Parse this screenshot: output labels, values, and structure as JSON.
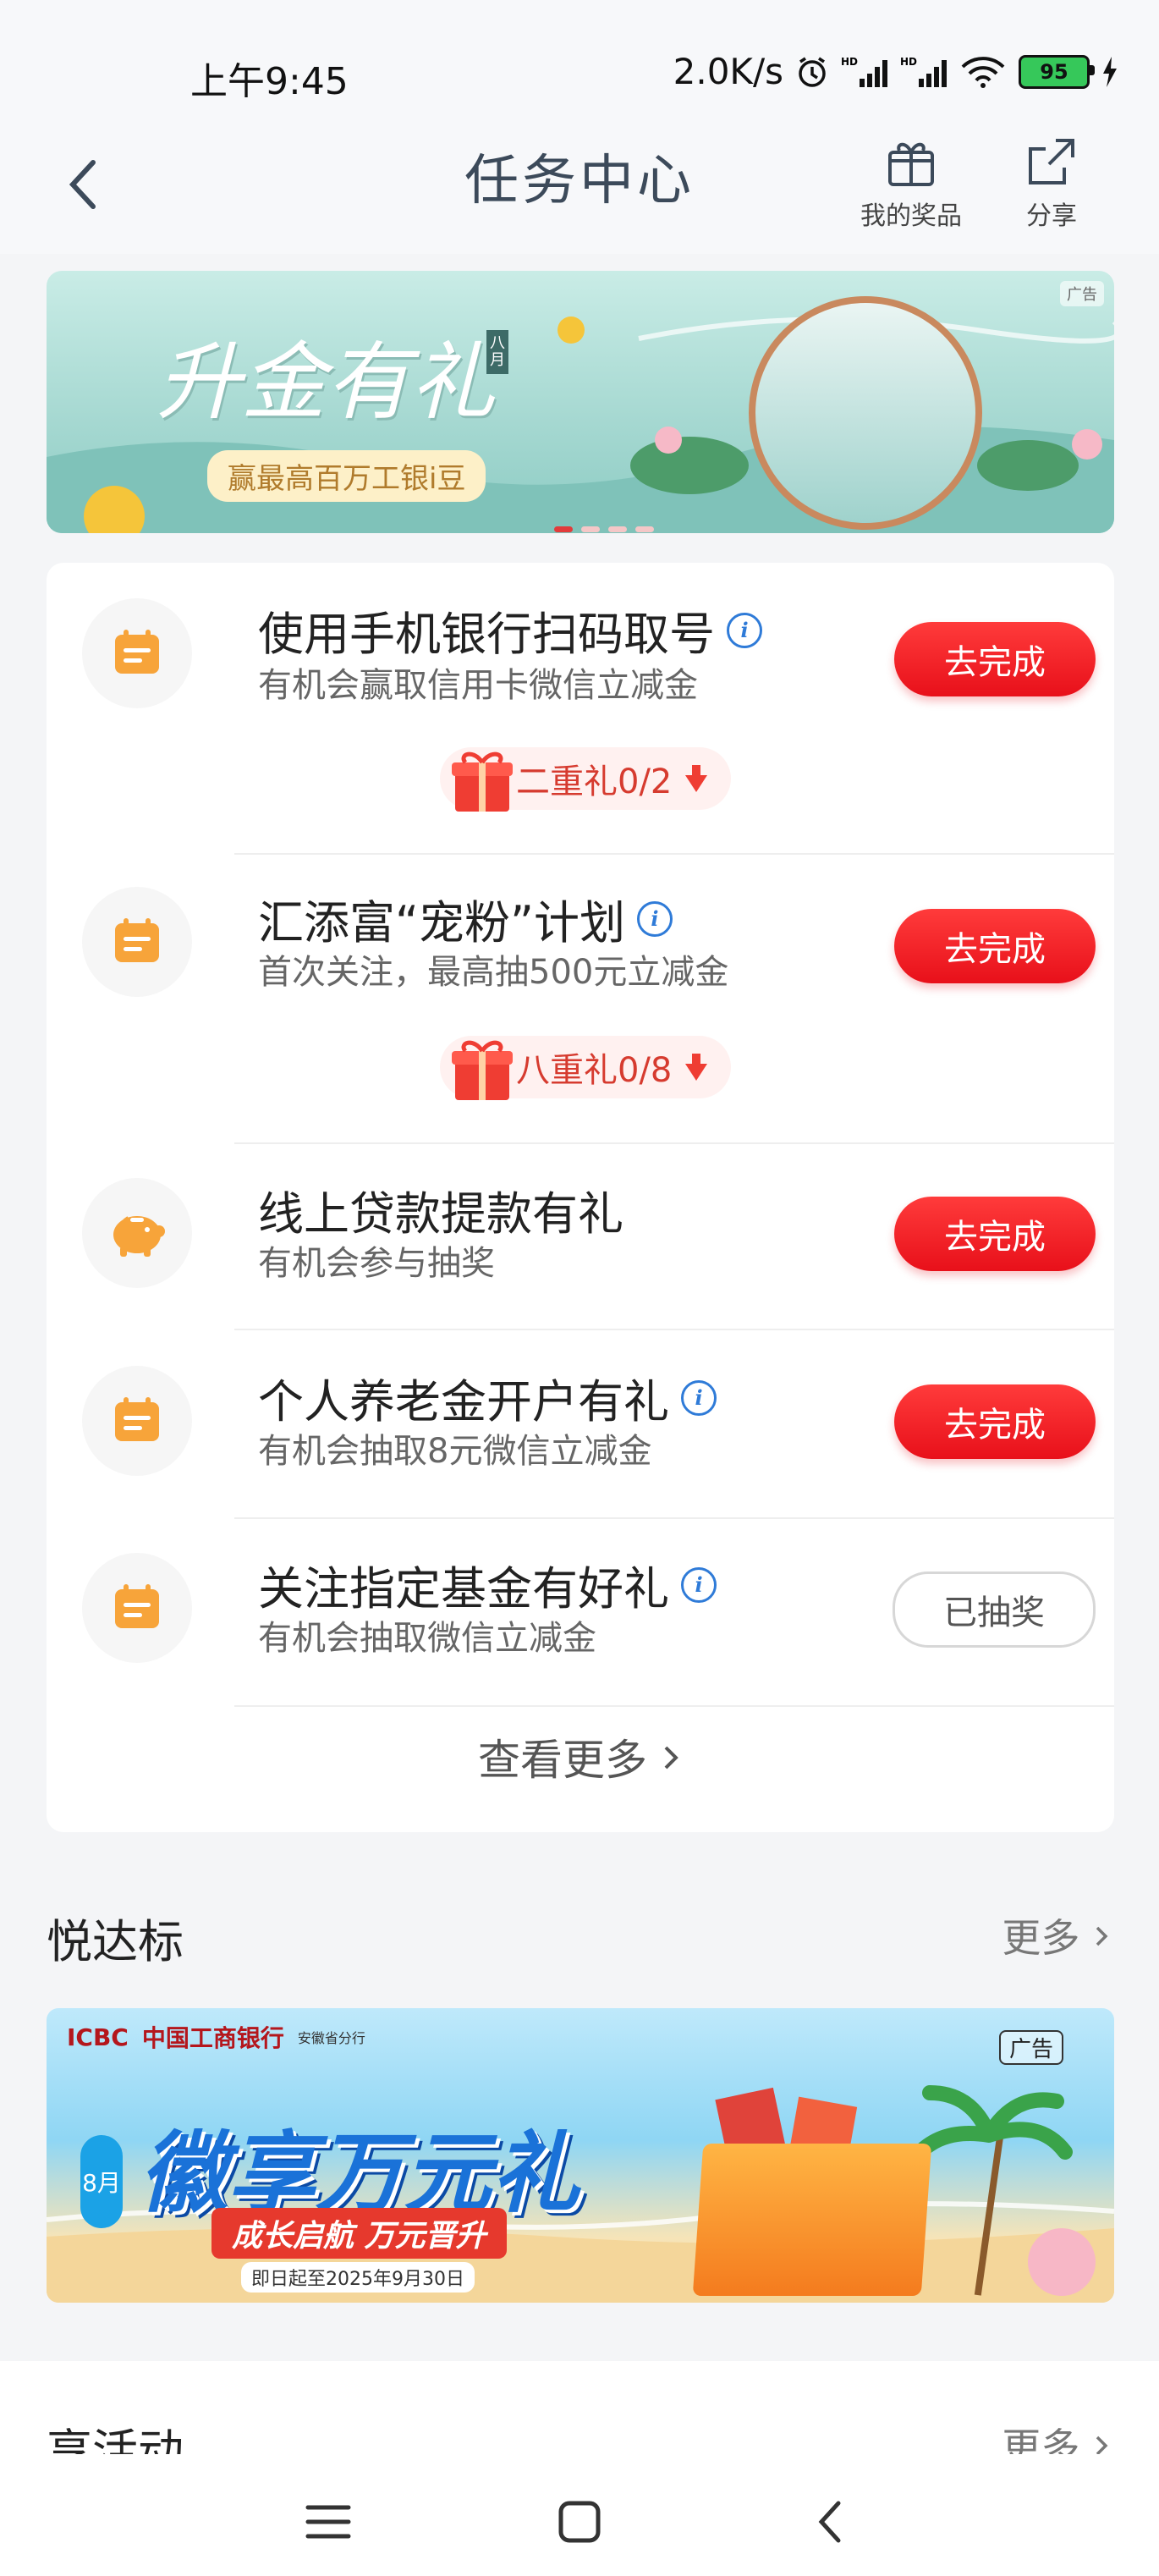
{
  "status_bar": {
    "time": "上午9:45",
    "network_speed": "2.0K/s",
    "battery": "95"
  },
  "header": {
    "title": "任务中心",
    "actions": [
      {
        "label": "我的奖品",
        "icon": "gift-icon"
      },
      {
        "label": "分享",
        "icon": "share-icon"
      }
    ]
  },
  "banner_top": {
    "title": "升金有礼",
    "subtitle": "赢最高百万工银i豆",
    "tag": "八月",
    "ad_label": "广告"
  },
  "tasks": [
    {
      "title": "使用手机银行扫码取号",
      "desc": "有机会赢取信用卡微信立减金",
      "button": "去完成",
      "info": true,
      "gift": "二重礼0/2",
      "icon": "calendar-icon"
    },
    {
      "title": "汇添富“宠粉”计划",
      "desc": "首次关注，最高抽500元立减金",
      "button": "去完成",
      "info": true,
      "gift": "八重礼0/8",
      "icon": "calendar-icon"
    },
    {
      "title": "线上贷款提款有礼",
      "desc": "有机会参与抽奖",
      "button": "去完成",
      "info": false,
      "icon": "piggy-bank-icon"
    },
    {
      "title": "个人养老金开户有礼",
      "desc": "有机会抽取8元微信立减金",
      "button": "去完成",
      "info": true,
      "icon": "calendar-icon"
    },
    {
      "title": "关注指定基金有好礼",
      "desc": "有机会抽取微信立减金",
      "button": "已抽奖",
      "info": true,
      "icon": "calendar-icon"
    }
  ],
  "view_more": "查看更多",
  "section_yuedabiao": {
    "title": "悦达标",
    "more": "更多"
  },
  "banner_icbc": {
    "bank": "ICBC",
    "bank_cn": "中国工商银行",
    "branch": "安徽省分行",
    "title": "徽享万元礼",
    "subtitle": "成长启航 万元晋升",
    "date": "即日起至2025年9月30日",
    "month": "8月",
    "ad_label": "广告"
  },
  "section_activity": {
    "title": "享活动",
    "more": "更多"
  },
  "colors": {
    "accent_red": "#e8101a",
    "icon_orange": "#f7a43a",
    "info_blue": "#2f7bd8"
  }
}
